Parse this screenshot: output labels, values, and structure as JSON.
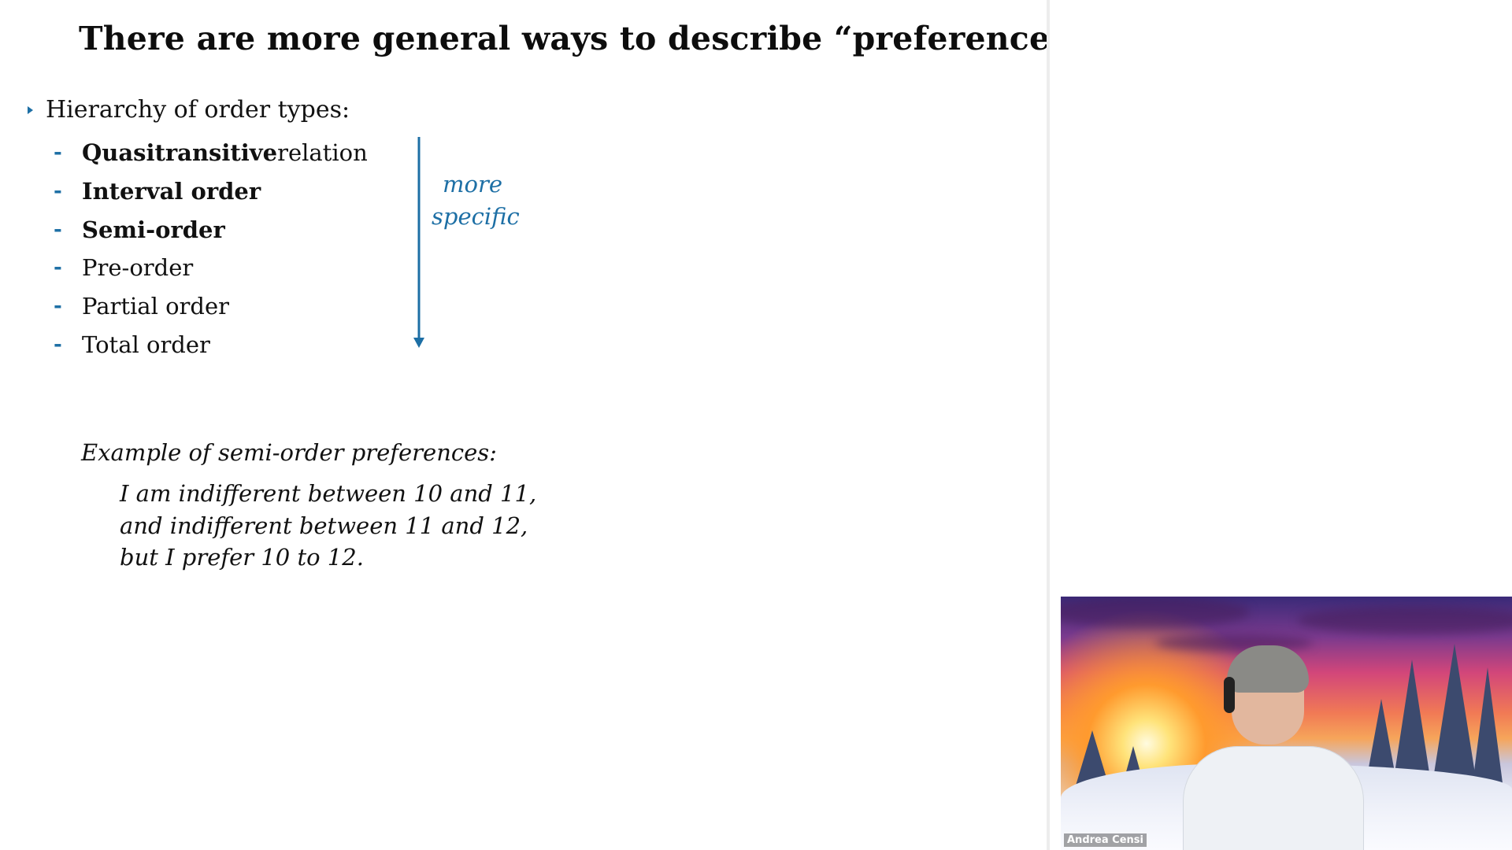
{
  "slide": {
    "title": "There are more general ways to describe “preferences”",
    "bullet": "Hierarchy of order types:",
    "order_types": [
      {
        "bold": "Quasitransitive",
        "rest": " relation"
      },
      {
        "bold": "Interval order",
        "rest": ""
      },
      {
        "bold": "Semi-order",
        "rest": ""
      },
      {
        "bold": "",
        "rest": "Pre-order"
      },
      {
        "bold": "",
        "rest": "Partial order"
      },
      {
        "bold": "",
        "rest": "Total order"
      }
    ],
    "dash": "-",
    "arrow_label": {
      "line1": "more",
      "line2": "specific"
    },
    "example": {
      "heading": "Example of semi-order preferences:",
      "lines": [
        "I am indifferent between 10 and 11,",
        "and indifferent between 11 and 12,",
        "but I prefer 10 to 12."
      ]
    }
  },
  "video": {
    "participant_name": "Andrea Censi"
  },
  "colors": {
    "accent": "#1d6fa5",
    "text": "#111111",
    "background": "#ffffff"
  }
}
